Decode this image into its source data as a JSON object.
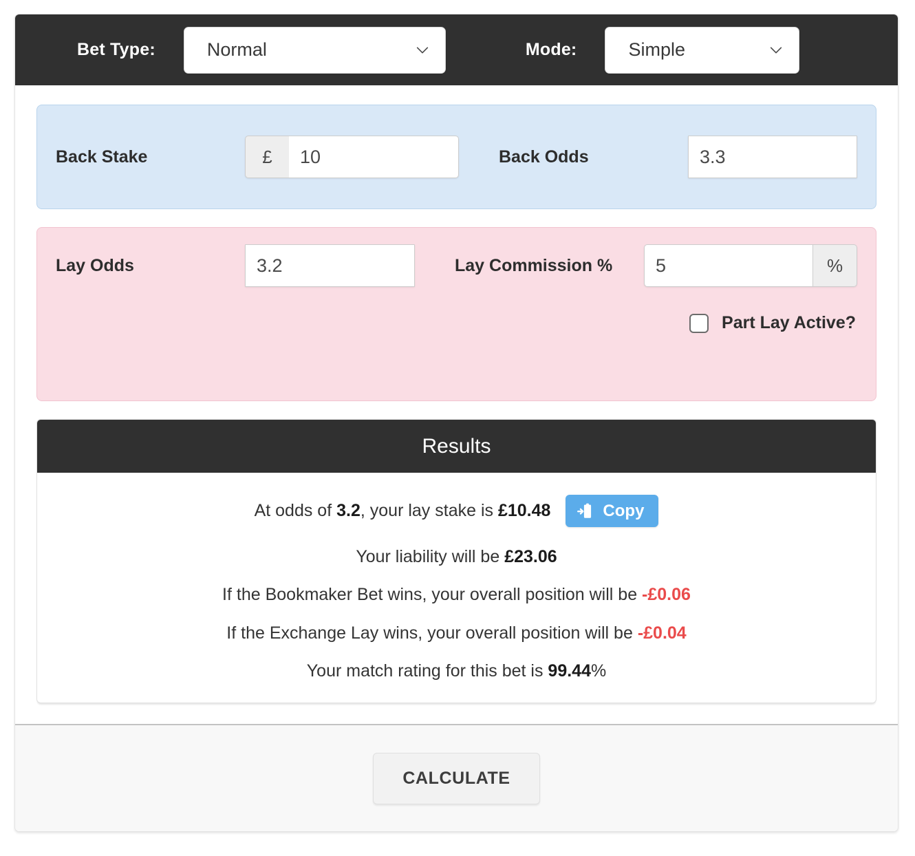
{
  "topbar": {
    "bet_type_label": "Bet Type:",
    "bet_type_value": "Normal",
    "mode_label": "Mode:",
    "mode_value": "Simple",
    "chevron_icon": "chevron-down-icon"
  },
  "back_panel": {
    "stake_label": "Back Stake",
    "stake_currency": "£",
    "stake_value": "10",
    "odds_label": "Back Odds",
    "odds_value": "3.3",
    "background_color": "#d9e8f7"
  },
  "lay_panel": {
    "odds_label": "Lay Odds",
    "odds_value": "3.2",
    "commission_label": "Lay Commission %",
    "commission_value": "5",
    "commission_suffix": "%",
    "part_lay_label": "Part Lay Active?",
    "part_lay_checked": false,
    "background_color": "#fadde4"
  },
  "results": {
    "title": "Results",
    "lay_stake_line": {
      "prefix": "At odds of ",
      "odds": "3.2",
      "middle": ", your lay stake is ",
      "stake": "£10.48"
    },
    "copy_button": {
      "label": "Copy",
      "icon": "clipboard-copy-icon",
      "color": "#5bacea"
    },
    "liability_line": {
      "prefix": "Your liability will be ",
      "value": "£23.06"
    },
    "bookmaker_line": {
      "prefix": "If the Bookmaker Bet wins, your overall position will be ",
      "value": "-£0.06"
    },
    "exchange_line": {
      "prefix": "If the Exchange Lay wins, your overall position will be ",
      "value": "-£0.04"
    },
    "rating_line": {
      "prefix": "Your match rating for this bet is ",
      "value": "99.44",
      "suffix": "%"
    },
    "negative_color": "#ea4b4b"
  },
  "footer": {
    "calculate_label": "CALCULATE"
  }
}
